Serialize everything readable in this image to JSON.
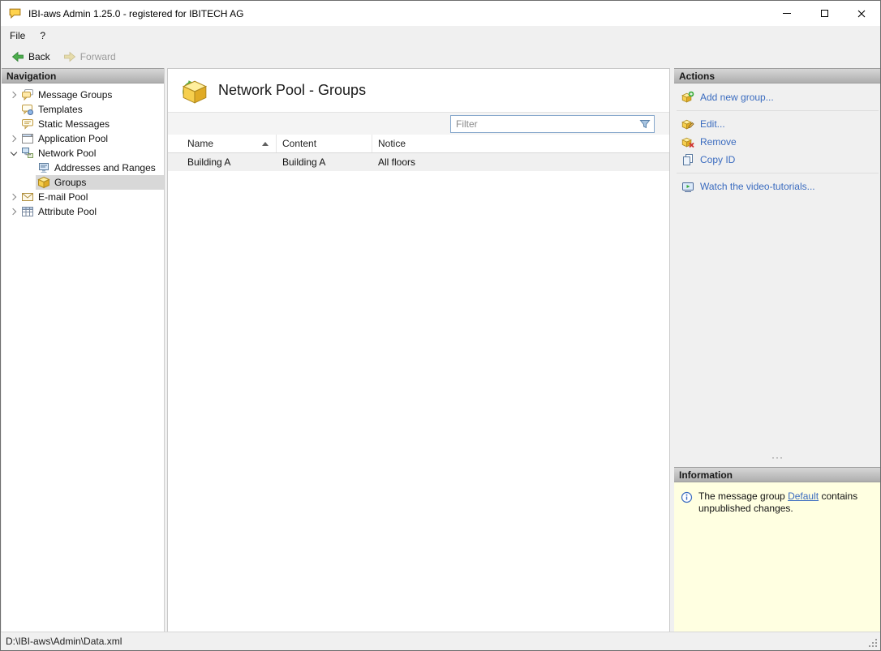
{
  "colors": {
    "link": "#3a6bbf",
    "selection": "#d8d8d8",
    "info_background": "#ffffe1",
    "panel_header_top": "#d6d6d6",
    "panel_header_bottom": "#aeaeae",
    "back_arrow_green": "#4cae4c",
    "group_box_yellow": "#f6cf4e"
  },
  "window": {
    "title": "IBI-aws Admin 1.25.0 - registered for IBITECH AG",
    "menu": [
      {
        "label": "File"
      },
      {
        "label": "?"
      }
    ],
    "toolbar": {
      "back_label": "Back",
      "forward_label": "Forward"
    },
    "status_path": "D:\\IBI-aws\\Admin\\Data.xml"
  },
  "navigation": {
    "header": "Navigation",
    "items": [
      {
        "label": "Message Groups",
        "expanded": false,
        "level": 0
      },
      {
        "label": "Templates",
        "level": 0
      },
      {
        "label": "Static Messages",
        "level": 0
      },
      {
        "label": "Application Pool",
        "expanded": false,
        "level": 0
      },
      {
        "label": "Network Pool",
        "expanded": true,
        "level": 0
      },
      {
        "label": "Addresses and Ranges",
        "level": 1
      },
      {
        "label": "Groups",
        "level": 1,
        "selected": true
      },
      {
        "label": "E-mail Pool",
        "expanded": false,
        "level": 0
      },
      {
        "label": "Attribute Pool",
        "expanded": false,
        "level": 0
      }
    ]
  },
  "main": {
    "title": "Network Pool - Groups",
    "filter_placeholder": "Filter",
    "table": {
      "columns": [
        "Name",
        "Content",
        "Notice"
      ],
      "sort": {
        "column": "Name",
        "direction": "ascending"
      },
      "rows": [
        [
          "Building A",
          "Building A",
          "All floors"
        ]
      ]
    }
  },
  "actions": {
    "header": "Actions",
    "items": [
      {
        "label": "Add new group..."
      },
      {
        "label": "Edit..."
      },
      {
        "label": "Remove"
      },
      {
        "label": "Copy ID"
      },
      {
        "label": "Watch the video-tutorials..."
      }
    ]
  },
  "information": {
    "header": "Information",
    "text_before": "The message group",
    "link_label": "Default",
    "text_after": "contains unpublished changes."
  }
}
